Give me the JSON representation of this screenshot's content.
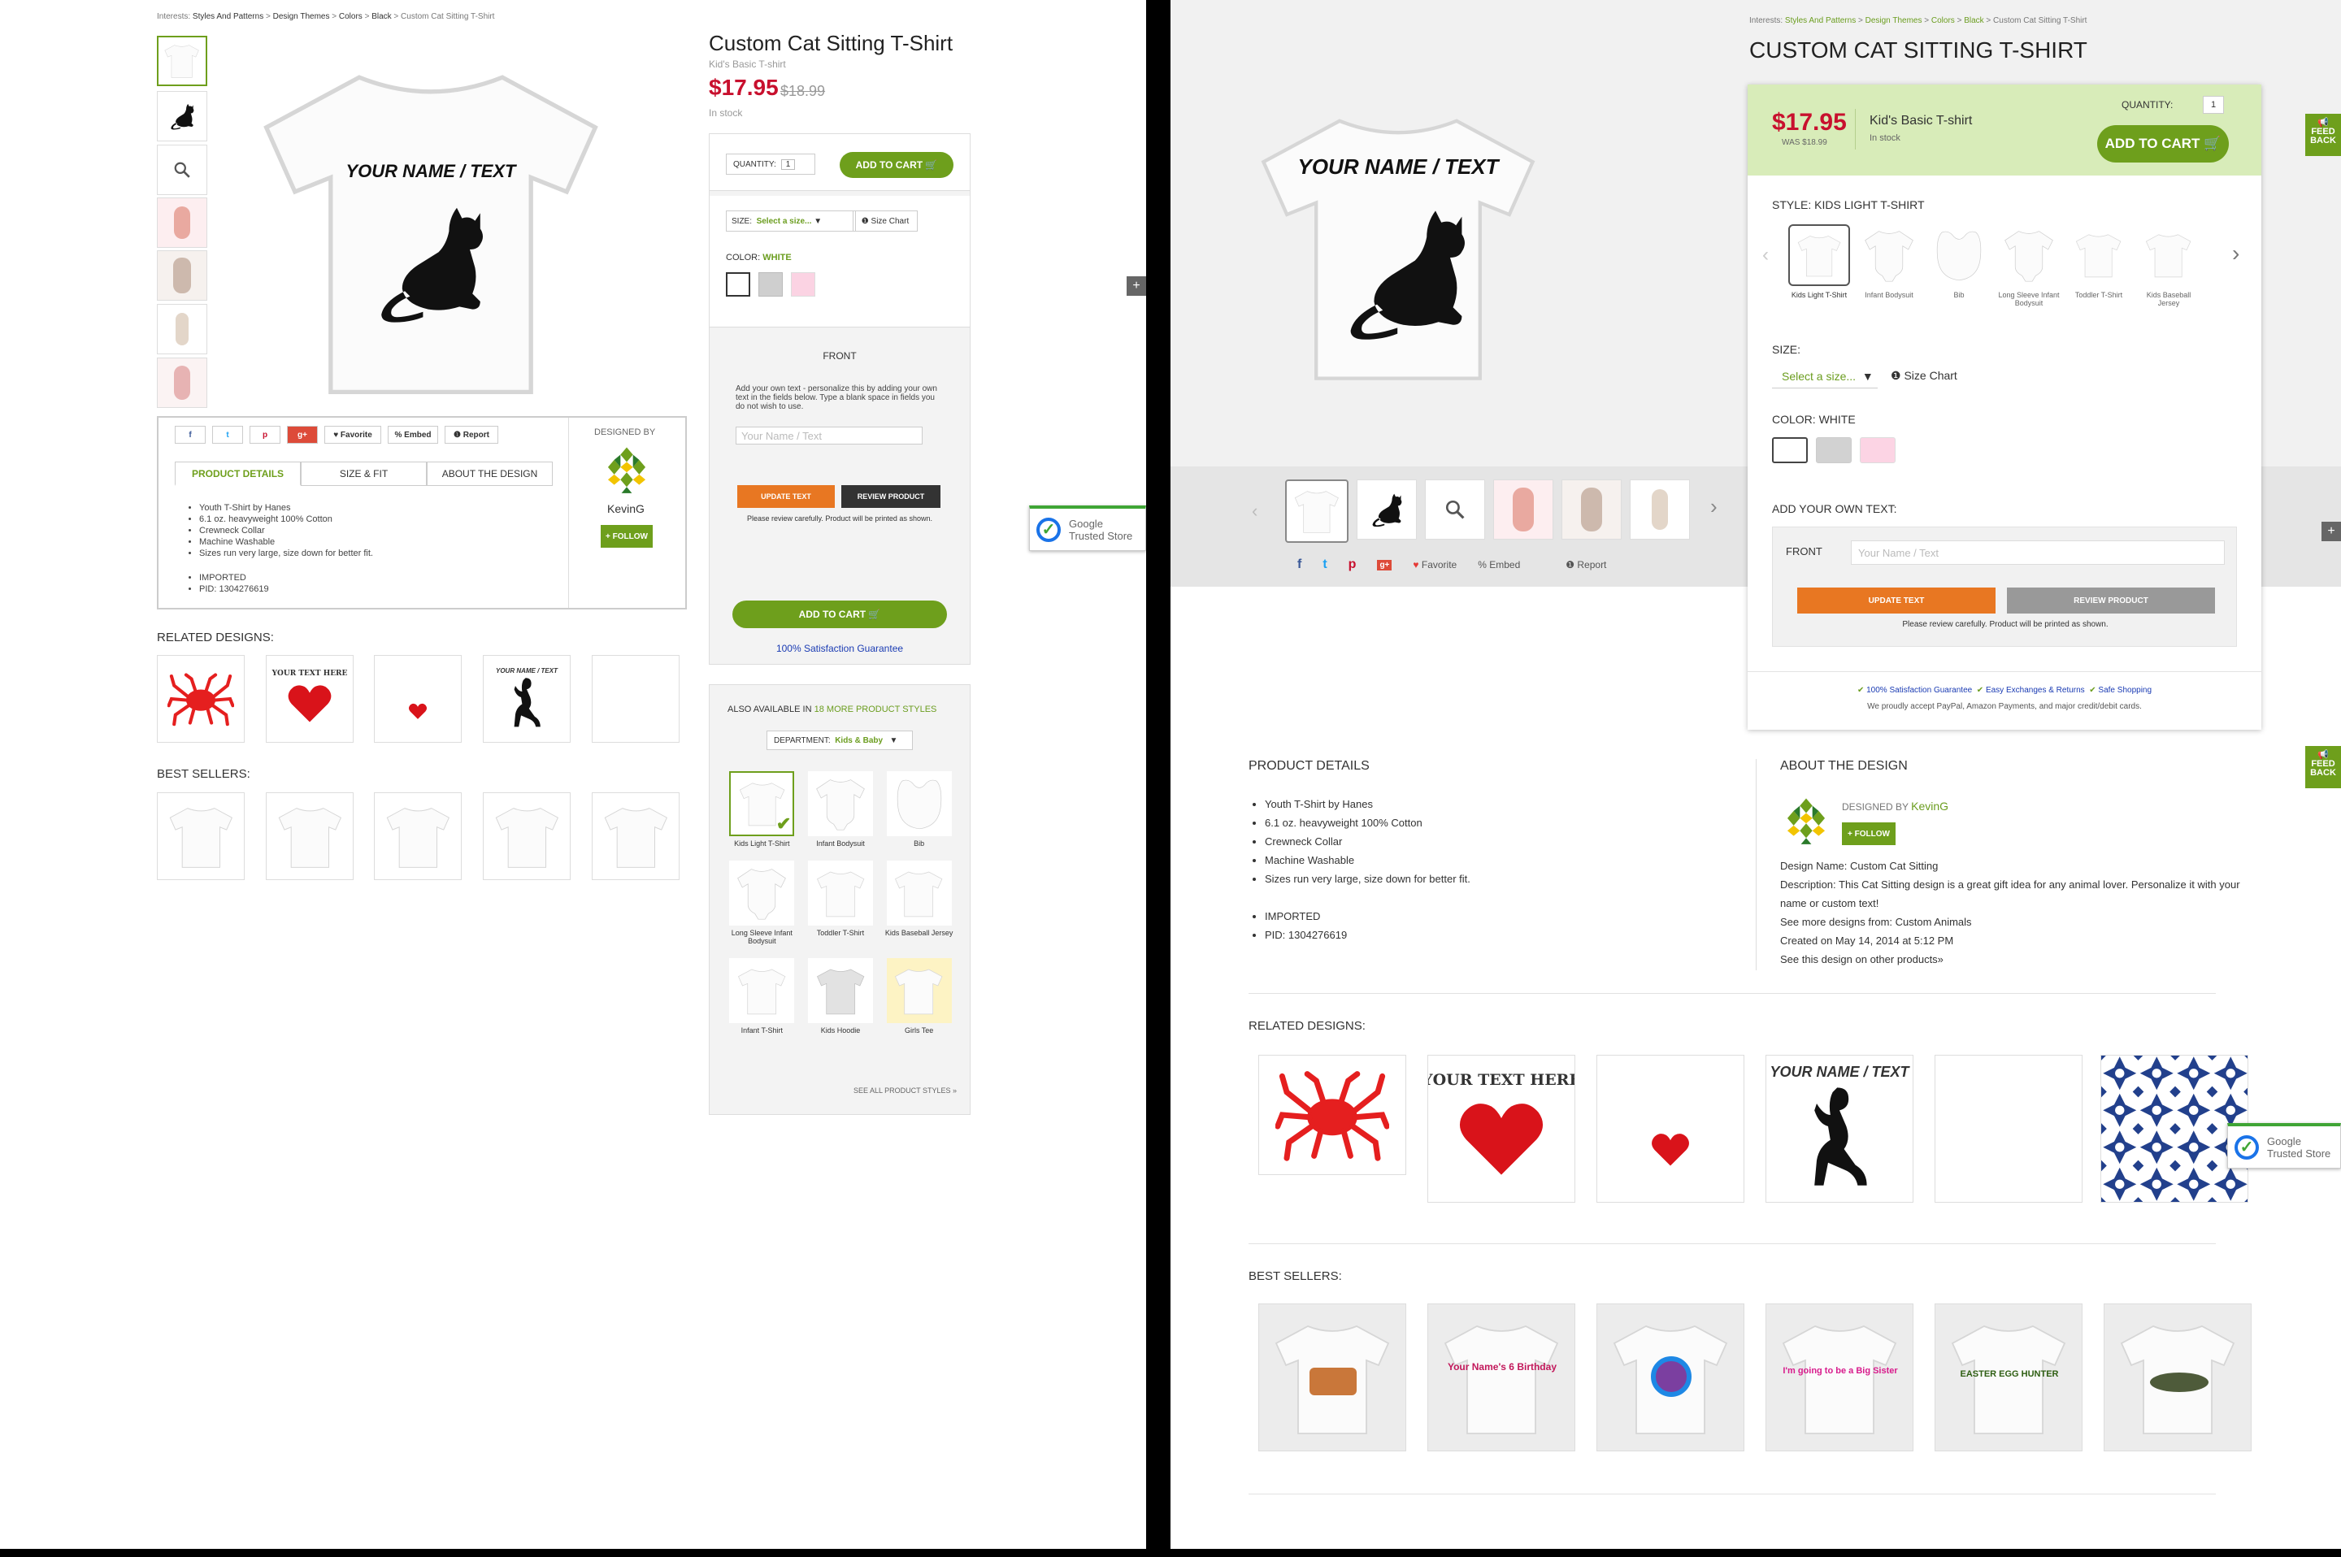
{
  "left_page": {
    "breadcrumb": {
      "prefix": "Interests:",
      "items": [
        "Styles And Patterns",
        "Design Themes",
        "Colors",
        "Black"
      ],
      "current": "Custom Cat Sitting T-Shirt",
      "sep": ">"
    },
    "product": {
      "title": "Custom Cat Sitting T-Shirt",
      "subtitle": "Kid's Basic T-shirt",
      "price": "$17.95",
      "old_price": "$18.99",
      "stock": "In stock"
    },
    "design_text": "YOUR NAME / TEXT",
    "social": {
      "favorite": "♥ Favorite",
      "embed": "% Embed",
      "report": "❶ Report"
    },
    "tabs": [
      "PRODUCT DETAILS",
      "SIZE & FIT",
      "ABOUT THE DESIGN"
    ],
    "details": [
      "Youth T-Shirt by Hanes",
      "6.1 oz. heavyweight 100% Cotton",
      "Crewneck Collar",
      "Machine Washable",
      "Sizes run very large, size down for better fit."
    ],
    "extra": [
      "IMPORTED",
      "PID: 1304276619"
    ],
    "designer": {
      "label": "DESIGNED BY",
      "name": "KevinG",
      "follow": "+ FOLLOW"
    },
    "related_title": "RELATED DESIGNS:",
    "related_text": [
      "YOUR TEXT HERE",
      "YOUR NAME / TEXT"
    ],
    "bestsellers_title": "BEST SELLERS:",
    "cart": {
      "qty_label": "QUANTITY:",
      "qty": "1",
      "add": "ADD TO CART",
      "size_label": "SIZE:",
      "size_value": "Select a size...",
      "size_chart": "Size Chart",
      "color_label": "COLOR:",
      "color_value": "WHITE"
    },
    "personalize": {
      "front": "FRONT",
      "help": "Add your own text - personalize this by adding your own text in the fields below. Type a blank space in fields you do not wish to use.",
      "placeholder": "Your Name / Text",
      "update": "UPDATE TEXT",
      "review": "REVIEW PRODUCT",
      "note": "Please review carefully. Product will be printed as shown.",
      "add": "ADD TO CART",
      "guarantee": "100% Satisfaction Guarantee"
    },
    "also": {
      "label": "ALSO AVAILABLE IN",
      "count": "18 MORE PRODUCT STYLES",
      "dept_label": "DEPARTMENT:",
      "dept": "Kids & Baby",
      "see_all": "SEE ALL PRODUCT STYLES »",
      "items": [
        "Kids Light T-Shirt",
        "Infant Bodysuit",
        "Bib",
        "Long Sleeve Infant Bodysuit",
        "Toddler T-Shirt",
        "Kids Baseball Jersey",
        "Infant T-Shirt",
        "Kids Hoodie",
        "Girls Tee"
      ]
    },
    "gts": [
      "Google",
      "Trusted Store"
    ]
  },
  "right_page": {
    "breadcrumb": {
      "prefix": "Interests:",
      "items": [
        "Styles And Patterns",
        "Design Themes",
        "Colors",
        "Black"
      ],
      "current": "Custom Cat Sitting T-Shirt",
      "sep": ">"
    },
    "title": "CUSTOM CAT SITTING T-SHIRT",
    "design_text": "YOUR NAME / TEXT",
    "panel": {
      "price": "$17.95",
      "was": "WAS $18.99",
      "product": "Kid's Basic T-shirt",
      "stock": "In stock",
      "qty_label": "QUANTITY:",
      "qty": "1",
      "add": "ADD TO CART"
    },
    "style_label": "STYLE: KIDS LIGHT T-SHIRT",
    "styles": [
      "Kids Light T-Shirt",
      "Infant Bodysuit",
      "Bib",
      "Long Sleeve Infant Bodysuit",
      "Toddler T-Shirt",
      "Kids Baseball Jersey"
    ],
    "size_label": "SIZE:",
    "size_value": "Select a size...",
    "size_chart": "Size Chart",
    "color_label": "COLOR: WHITE",
    "own_text_label": "ADD YOUR OWN TEXT:",
    "front": "FRONT",
    "placeholder": "Your Name / Text",
    "update": "UPDATE TEXT",
    "review": "REVIEW PRODUCT",
    "note": "Please review carefully. Product will be printed as shown.",
    "assurances": [
      "100% Satisfaction Guarantee",
      "Easy Exchanges & Returns",
      "Safe Shopping"
    ],
    "payments": "We proudly accept PayPal, Amazon Payments, and major credit/debit cards.",
    "social": {
      "favorite": "Favorite",
      "embed": "Embed",
      "report": "Report"
    },
    "product_details_title": "PRODUCT DETAILS",
    "details": [
      "Youth T-Shirt by Hanes",
      "6.1 oz. heavyweight 100% Cotton",
      "Crewneck Collar",
      "Machine Washable",
      "Sizes run very large, size down for better fit."
    ],
    "extra": [
      "IMPORTED",
      "PID: 1304276619"
    ],
    "about_title": "ABOUT THE DESIGN",
    "designed_by": "DESIGNED BY",
    "designer": "KevinG",
    "follow": "+ FOLLOW",
    "about_lines": [
      "Design Name: Custom Cat Sitting",
      "Description: This Cat Sitting design is a great gift idea for any animal lover. Personalize it with your",
      "name or custom text!",
      "See more designs from: Custom Animals",
      "Created on May 14, 2014 at 5:12 PM",
      "See this design on other products»"
    ],
    "related_title": "RELATED DESIGNS:",
    "related_text": [
      "YOUR TEXT HERE",
      "YOUR NAME / TEXT"
    ],
    "bestsellers_title": "BEST SELLERS:",
    "bestseller_texts": [
      "",
      "Your Name's 6 Birthday",
      "",
      "I'm going to be a Big Sister",
      "EASTER EGG HUNTER",
      ""
    ],
    "feedback": "FEED BACK",
    "gts": [
      "Google",
      "Trusted Store"
    ]
  },
  "colors": {
    "green": "#6e9f1c",
    "red": "#c8102e",
    "orange": "#e87722",
    "panel_green": "#d8ecb9"
  }
}
